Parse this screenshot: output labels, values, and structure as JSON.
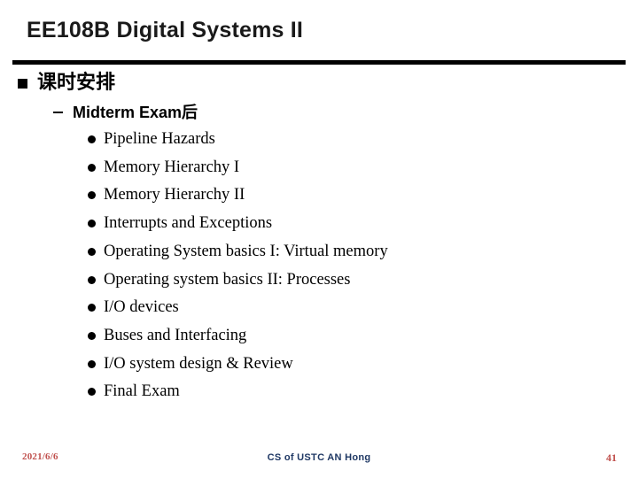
{
  "slide": {
    "title": "EE108B Digital Systems II",
    "outline": {
      "level1": "课时安排",
      "level2": "Midterm Exam后",
      "items": [
        "Pipeline Hazards",
        "Memory Hierarchy I",
        "Memory Hierarchy II",
        "Interrupts and Exceptions",
        "Operating System basics I: Virtual memory",
        "Operating system basics II: Processes",
        "I/O devices",
        "Buses and Interfacing",
        "I/O system design  & Review",
        "Final Exam"
      ]
    },
    "footer": {
      "date": "2021/6/6",
      "center": "CS of USTC AN Hong",
      "page": "41"
    },
    "colors": {
      "rule": "#000000",
      "footer_accent": "#c0504d",
      "footer_center": "#1f3864",
      "title": "#1a1a1a"
    }
  }
}
